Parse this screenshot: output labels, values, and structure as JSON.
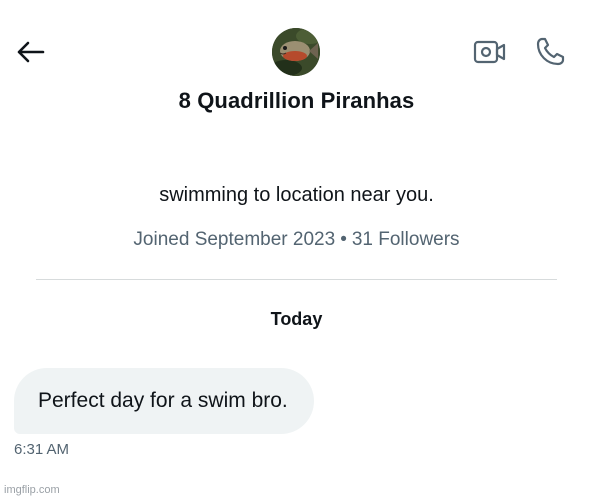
{
  "header": {
    "back_icon": "arrow-left-icon",
    "video_icon": "video-camera-icon",
    "call_icon": "phone-icon"
  },
  "profile": {
    "display_name": "8 Quadrillion Piranhas",
    "bio": "swimming to location near you.",
    "joined": "Joined September 2023",
    "followers": "31 Followers",
    "separator": "•"
  },
  "conversation": {
    "day_label": "Today",
    "messages": [
      {
        "text": "Perfect day for a swim bro.",
        "time": "6:31 AM"
      }
    ]
  },
  "watermark": "imgflip.com",
  "colors": {
    "text": "#0f1419",
    "secondary": "#536471",
    "bubble": "#eff3f4",
    "divider": "#d7dbdc"
  }
}
